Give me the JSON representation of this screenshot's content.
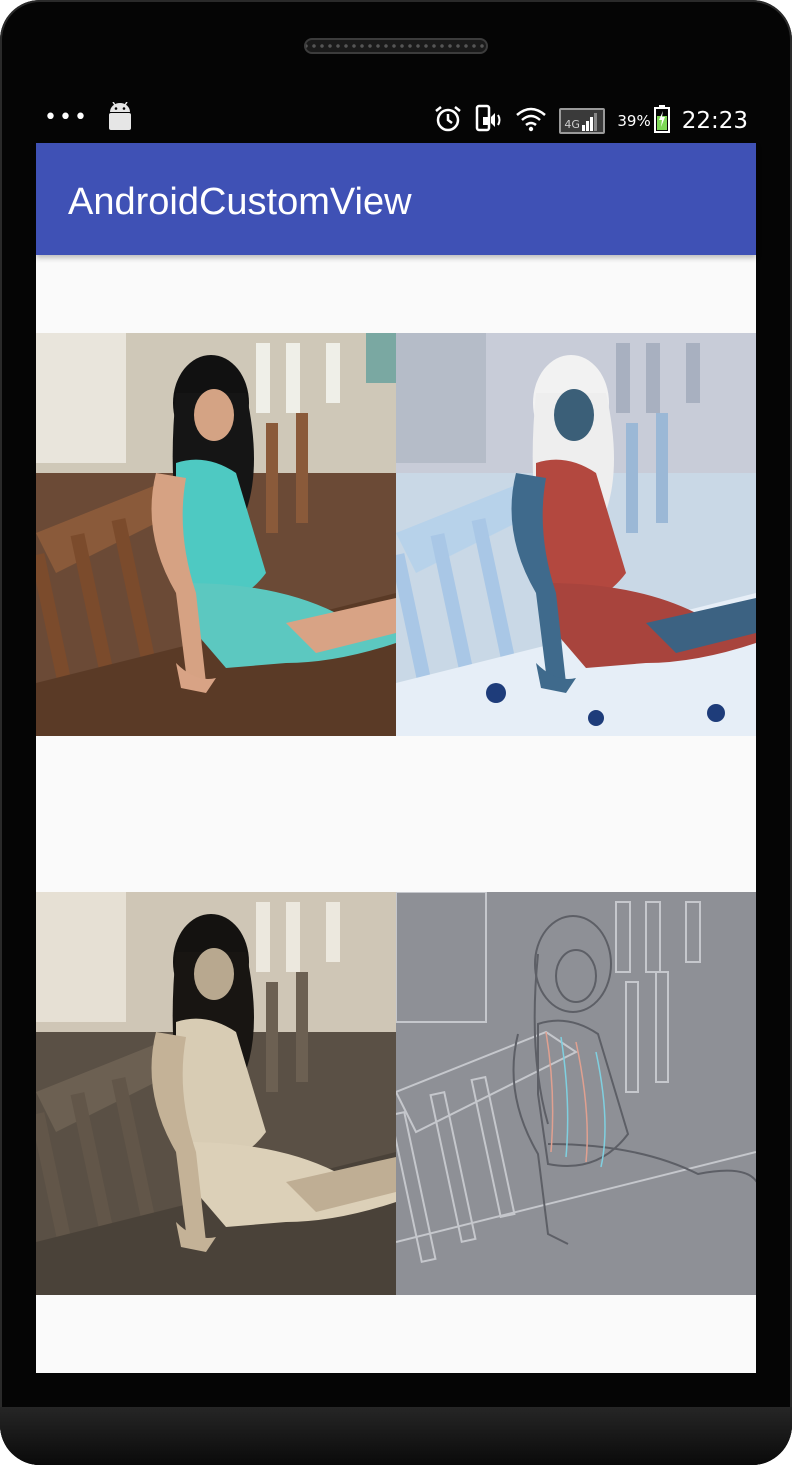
{
  "status_bar": {
    "overflow_dots": "•••",
    "network_type": "4G",
    "battery_percent": "39%",
    "time": "22:23",
    "icons": [
      "android-icon",
      "alarm-icon",
      "vibrate-icon",
      "wifi-icon",
      "signal-icon",
      "battery-icon"
    ]
  },
  "app_bar": {
    "title": "AndroidCustomView",
    "color": "#3f51b5"
  },
  "images": [
    {
      "name": "original",
      "effect": "original"
    },
    {
      "name": "inverted",
      "effect": "negative"
    },
    {
      "name": "sepia",
      "effect": "sepia"
    },
    {
      "name": "emboss",
      "effect": "emboss"
    }
  ]
}
